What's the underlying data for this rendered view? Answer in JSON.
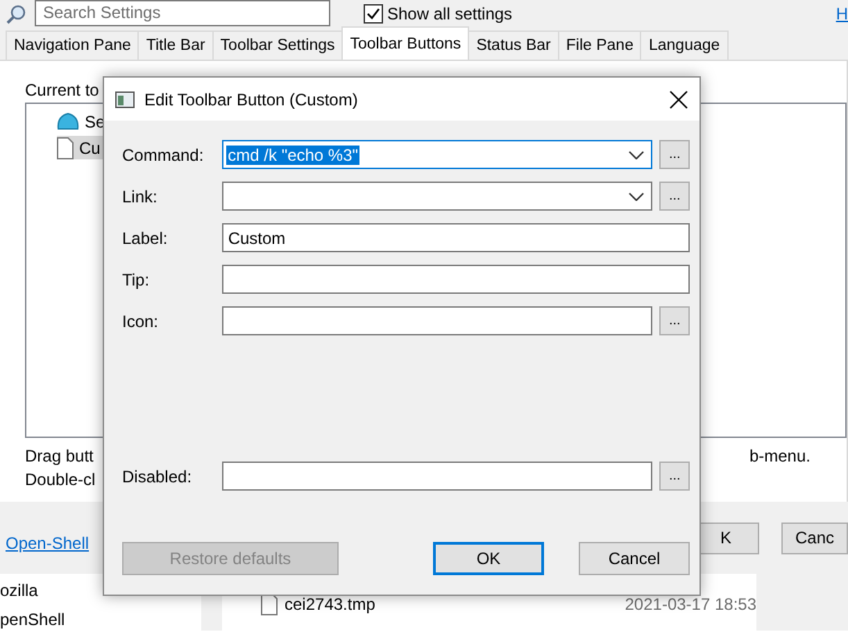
{
  "settings": {
    "search": {
      "placeholder": "Search Settings"
    },
    "show_all": {
      "label": "Show all settings",
      "checked": true
    },
    "help_link": "H",
    "tabs": [
      {
        "label": "Navigation Pane",
        "selected": false
      },
      {
        "label": "Title Bar",
        "selected": false
      },
      {
        "label": "Toolbar Settings",
        "selected": false
      },
      {
        "label": "Toolbar Buttons",
        "selected": true
      },
      {
        "label": "Status Bar",
        "selected": false
      },
      {
        "label": "File Pane",
        "selected": false
      },
      {
        "label": "Language",
        "selected": false
      }
    ],
    "current_label": "Current to",
    "tree": [
      {
        "label": "Se",
        "kind": "shell",
        "selected": false
      },
      {
        "label": "Cu",
        "kind": "page",
        "selected": true
      }
    ],
    "hint_lines": [
      {
        "left": "Drag butt",
        "right": "b-menu."
      },
      {
        "left": "Double-cl"
      }
    ],
    "link": "Open-Shell",
    "buttons": [
      "K",
      "Canc"
    ]
  },
  "dialog": {
    "title": "Edit Toolbar Button (Custom)",
    "fields": [
      {
        "label": "Command:",
        "value": "cmd /k \"echo %3\"",
        "kind": "combo",
        "browse": "...",
        "focused": true
      },
      {
        "label": "Link:",
        "kind": "combo",
        "browse": "...",
        "focused": false
      },
      {
        "label": "Label:",
        "value": "Custom",
        "kind": "text",
        "focused": false
      },
      {
        "label": "Tip:",
        "kind": "text",
        "focused": false
      },
      {
        "label": "Icon:",
        "kind": "text",
        "browse": "...",
        "focused": false
      },
      {
        "label": "Disabled:",
        "kind": "text",
        "browse": "...",
        "focused": false
      }
    ],
    "buttons": [
      {
        "label": "Restore defaults",
        "disabled": true,
        "default": false
      },
      {
        "label": "OK",
        "disabled": false,
        "default": true
      },
      {
        "label": "Cancel",
        "disabled": false,
        "default": false
      }
    ]
  },
  "explorer": {
    "folders": [
      "ozilla",
      "penShell"
    ],
    "files": [
      {
        "name": "cei2743.tmp",
        "date": "2021-03-17 18:53"
      }
    ]
  }
}
